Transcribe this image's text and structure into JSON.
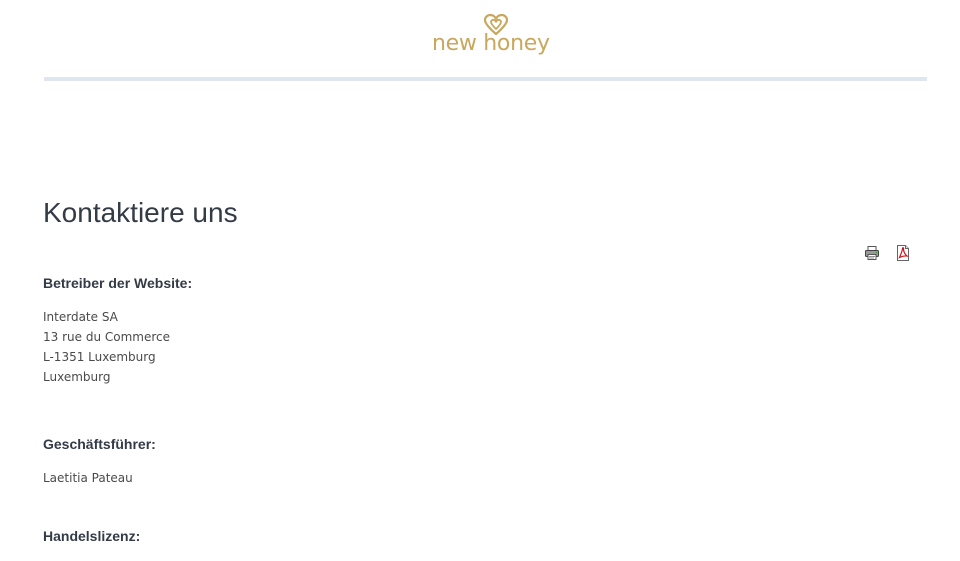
{
  "header": {
    "logo_text": "new honey",
    "logo_icon": "heart-icon",
    "accent_color": "#c9a75c"
  },
  "page": {
    "title": "Kontaktiere uns"
  },
  "tools": {
    "print_icon": "printer-icon",
    "pdf_icon": "pdf-icon"
  },
  "sections": {
    "operator": {
      "heading": "Betreiber der Website:",
      "lines": [
        "Interdate SA",
        "13 rue du Commerce",
        "L-1351 Luxemburg",
        "Luxemburg"
      ]
    },
    "manager": {
      "heading": "Geschäftsführer:",
      "lines": [
        "Laetitia Pateau"
      ]
    },
    "license": {
      "heading": "Handelslizenz:"
    }
  }
}
